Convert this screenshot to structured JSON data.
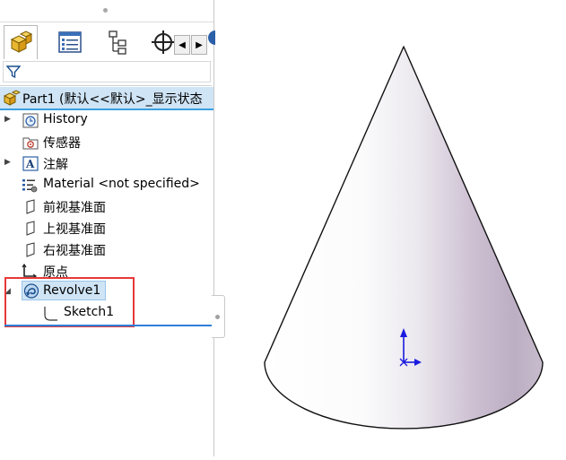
{
  "tree": {
    "part": {
      "label": "Part1  (默认<<默认>_显示状态",
      "icon": "part-icon"
    },
    "items": [
      {
        "label": "History",
        "icon": "history-icon",
        "expandable": true
      },
      {
        "label": "传感器",
        "icon": "sensor-icon",
        "expandable": false
      },
      {
        "label": "注解",
        "icon": "annotation-icon",
        "expandable": true
      },
      {
        "label": "Material <not specified>",
        "icon": "material-icon",
        "expandable": false
      },
      {
        "label": "前视基准面",
        "icon": "plane-icon",
        "expandable": false
      },
      {
        "label": "上视基准面",
        "icon": "plane-icon",
        "expandable": false
      },
      {
        "label": "右视基准面",
        "icon": "plane-icon",
        "expandable": false
      },
      {
        "label": "原点",
        "icon": "origin-icon",
        "expandable": false
      },
      {
        "label": "Revolve1",
        "icon": "revolve-icon",
        "expandable": true,
        "expanded": true,
        "selected": true
      },
      {
        "label": "Sketch1",
        "icon": "sketch-icon",
        "expandable": false
      }
    ]
  },
  "tabs": [
    {
      "name": "featuremanager-tab",
      "icon": "part-feature-icon",
      "active": true
    },
    {
      "name": "propertymanager-tab",
      "icon": "property-list-icon"
    },
    {
      "name": "configurationmanager-tab",
      "icon": "configuration-icon"
    },
    {
      "name": "dimxpert-tab",
      "icon": "crosshair-icon"
    }
  ],
  "scroll": {
    "left": "◀",
    "right": "▶"
  },
  "colors": {
    "selection": "#cfe4f5",
    "highlight": "#e5393a",
    "accent": "#2f7fd8"
  }
}
